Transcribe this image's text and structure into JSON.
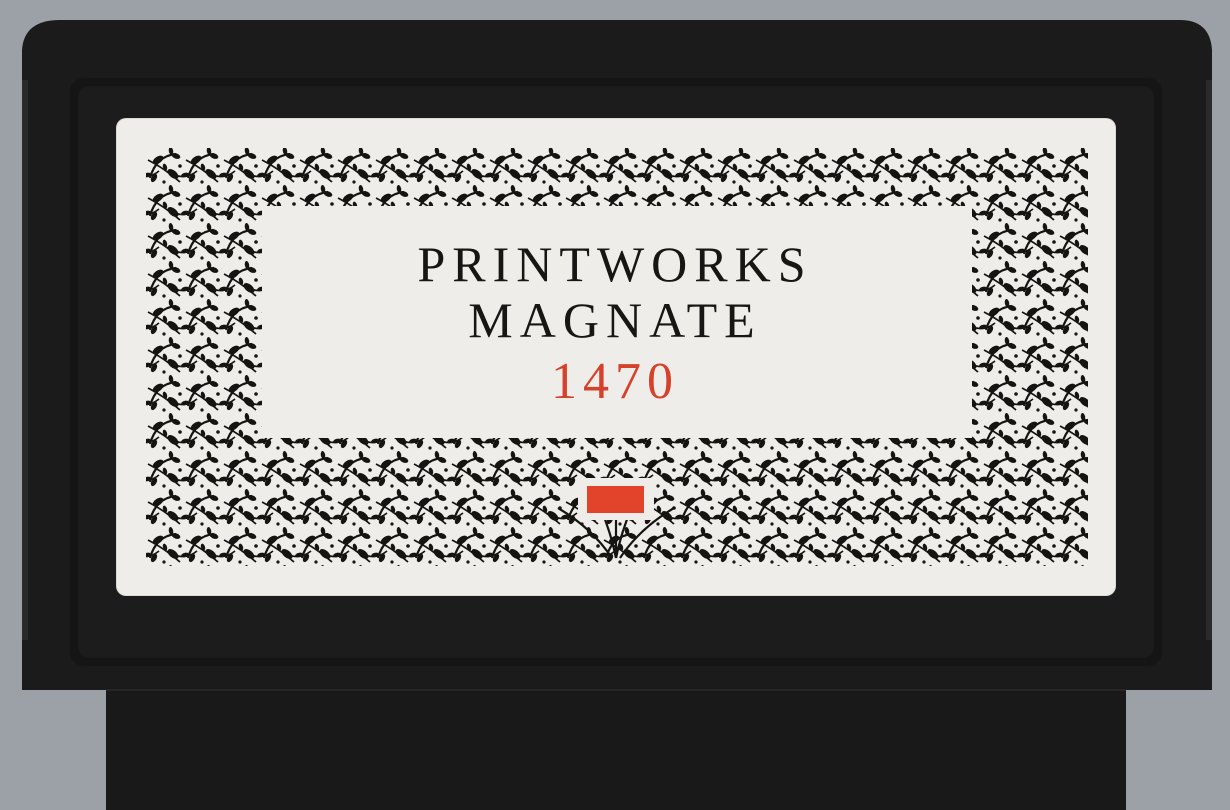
{
  "cartridge": {
    "title_line1": "PRINTWORKS",
    "title_line2": "MAGNATE",
    "year": "1470"
  },
  "colors": {
    "shell": "#1a1a1a",
    "label_bg": "#efedea",
    "ink": "#181614",
    "accent": "#e2432b",
    "background": "#9ca0a7"
  },
  "icons": {
    "ornament": "floral-vine-border-icon",
    "center_mark": "red-rectangle-icon"
  }
}
